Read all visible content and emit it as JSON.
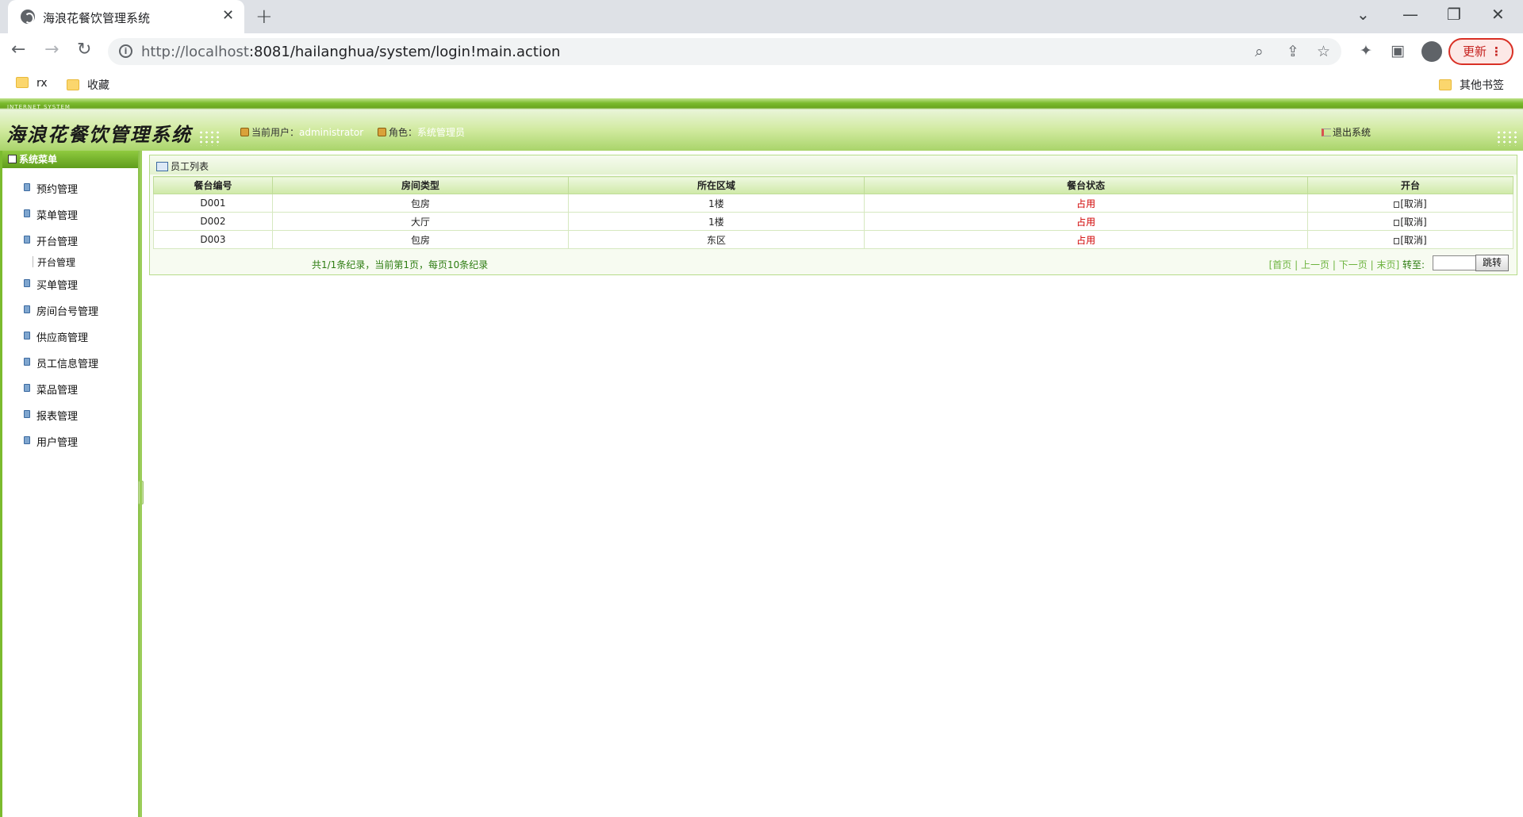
{
  "browser": {
    "tab_title": "海浪花餐饮管理系统",
    "tab_close": "✕",
    "new_tab": "+",
    "url_host": "http://localhost",
    "url_rest": ":8081/hailanghua/system/login!main.action",
    "update_label": "更新",
    "menu_dots": "⋮",
    "bookmarks": [
      "rx",
      "收藏"
    ],
    "other_bookmarks": "其他书签"
  },
  "header": {
    "tiny_caption": "INTERNET SYSTEM",
    "logo": "海浪花餐饮管理系统",
    "current_user_label": "当前用户：",
    "current_user": "administrator",
    "role_label": "角色：",
    "role": "系统管理员",
    "logout": "退出系统"
  },
  "sidebar": {
    "title": "系统菜单",
    "items": [
      {
        "label": "预约管理"
      },
      {
        "label": "菜单管理"
      },
      {
        "label": "开台管理"
      },
      {
        "label": "买单管理"
      },
      {
        "label": "房间台号管理"
      },
      {
        "label": "供应商管理"
      },
      {
        "label": "员工信息管理"
      },
      {
        "label": "菜品管理"
      },
      {
        "label": "报表管理"
      },
      {
        "label": "用户管理"
      }
    ],
    "sub_item": "开台管理"
  },
  "main": {
    "panel_title": "员工列表",
    "columns": [
      "餐台编号",
      "房间类型",
      "所在区域",
      "餐台状态",
      "开台"
    ],
    "rows": [
      {
        "id": "D001",
        "type": "包房",
        "area": "1楼",
        "status": "占用",
        "action": "[取消]"
      },
      {
        "id": "D002",
        "type": "大厅",
        "area": "1楼",
        "status": "占用",
        "action": "[取消]"
      },
      {
        "id": "D003",
        "type": "包房",
        "area": "东区",
        "status": "占用",
        "action": "[取消]"
      }
    ],
    "pager": {
      "summary": "共1/1条纪录，当前第1页，每页10条纪录",
      "first": "[首页",
      "prev": "上一页",
      "next": "下一页",
      "last": "末页]",
      "sep": "|",
      "goto_label": "转至:",
      "jump_value": "",
      "jump_button": "跳转"
    }
  },
  "colors": {
    "header_green": "#7bbb2e",
    "status_red": "#d00000",
    "pager_green": "#2e7d12"
  }
}
